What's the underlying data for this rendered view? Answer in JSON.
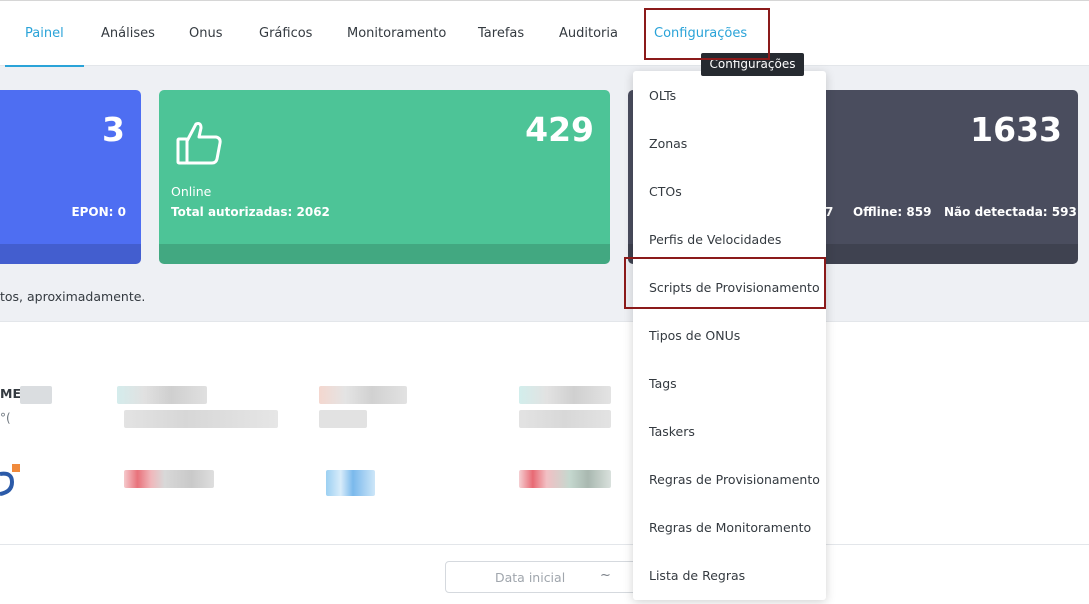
{
  "nav": {
    "tabs": [
      {
        "label": "Painel"
      },
      {
        "label": "Análises"
      },
      {
        "label": "Onus"
      },
      {
        "label": "Gráficos"
      },
      {
        "label": "Monitoramento"
      },
      {
        "label": "Tarefas"
      },
      {
        "label": "Auditoria"
      },
      {
        "label": "Configurações"
      }
    ],
    "active_tab": "Painel"
  },
  "cards": {
    "blue": {
      "value": "3",
      "stat": "EPON: 0",
      "color": "#4e6ef2"
    },
    "green": {
      "value": "429",
      "label": "Online",
      "stat": "Total autorizadas: 2062",
      "color": "#4dc497"
    },
    "dark": {
      "value": "1633",
      "stat_partial": "7",
      "stat_offline": "Offline: 859",
      "stat_undetected": "Não detectada: 593",
      "color": "#4a4d5e"
    }
  },
  "note": "tos, aproximadamente.",
  "panel": {
    "partial_text_1": "ME",
    "partial_text_2": "°("
  },
  "date_filter": {
    "placeholder": "Data inicial",
    "separator": "~"
  },
  "tooltip": "Configurações",
  "dropdown": {
    "items": [
      {
        "label": "OLTs"
      },
      {
        "label": "Zonas"
      },
      {
        "label": "CTOs"
      },
      {
        "label": "Perfis de Velocidades"
      },
      {
        "label": "Scripts de Provisionamento"
      },
      {
        "label": "Tipos de ONUs"
      },
      {
        "label": "Tags"
      },
      {
        "label": "Taskers"
      },
      {
        "label": "Regras de Provisionamento"
      },
      {
        "label": "Regras de Monitoramento"
      },
      {
        "label": "Lista de Regras"
      }
    ]
  },
  "colors": {
    "accent": "#2aa3d8",
    "highlight": "#8b1a1a"
  }
}
